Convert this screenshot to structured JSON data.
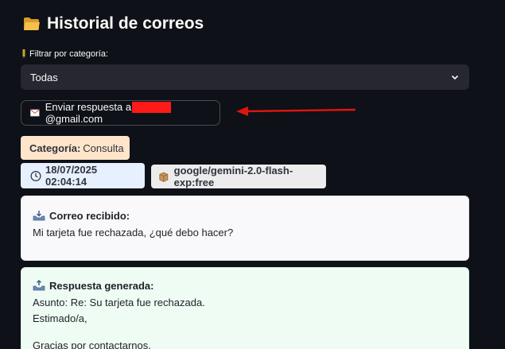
{
  "header": {
    "title": "Historial de correos",
    "icon": "folder-icon"
  },
  "filter": {
    "label": "Filtrar por categoría:",
    "selected": "Todas"
  },
  "send_button": {
    "label_prefix": "Enviar respuesta a",
    "label_suffix": "@gmail.com",
    "icon": "envelope-icon"
  },
  "category": {
    "label": "Categoría:",
    "value": "Consulta",
    "icon": "paperclip-icon"
  },
  "timestamp": {
    "value": "18/07/2025 02:04:14",
    "icon": "clock-icon"
  },
  "model": {
    "value": "google/gemini-2.0-flash-exp:free",
    "icon": "package-icon"
  },
  "received": {
    "title": "Correo recibido:",
    "body": "Mi tarjeta fue rechazada, ¿qué debo hacer?",
    "icon": "inbox-tray-icon"
  },
  "response": {
    "title": "Respuesta generada:",
    "subject": "Asunto: Re: Su tarjeta fue rechazada.",
    "greeting": "Estimado/a,",
    "line": "Gracias por contactarnos.",
    "icon": "outbox-tray-icon"
  },
  "colors": {
    "background": "#0e1117",
    "select_bg": "#262730",
    "category_bg": "#ffe5c9",
    "timestamp_bg": "#e7f0ff",
    "model_bg": "#ececec",
    "received_bg": "#f9f9fb",
    "response_bg": "#effcf3",
    "annotation": "#e0140f"
  }
}
